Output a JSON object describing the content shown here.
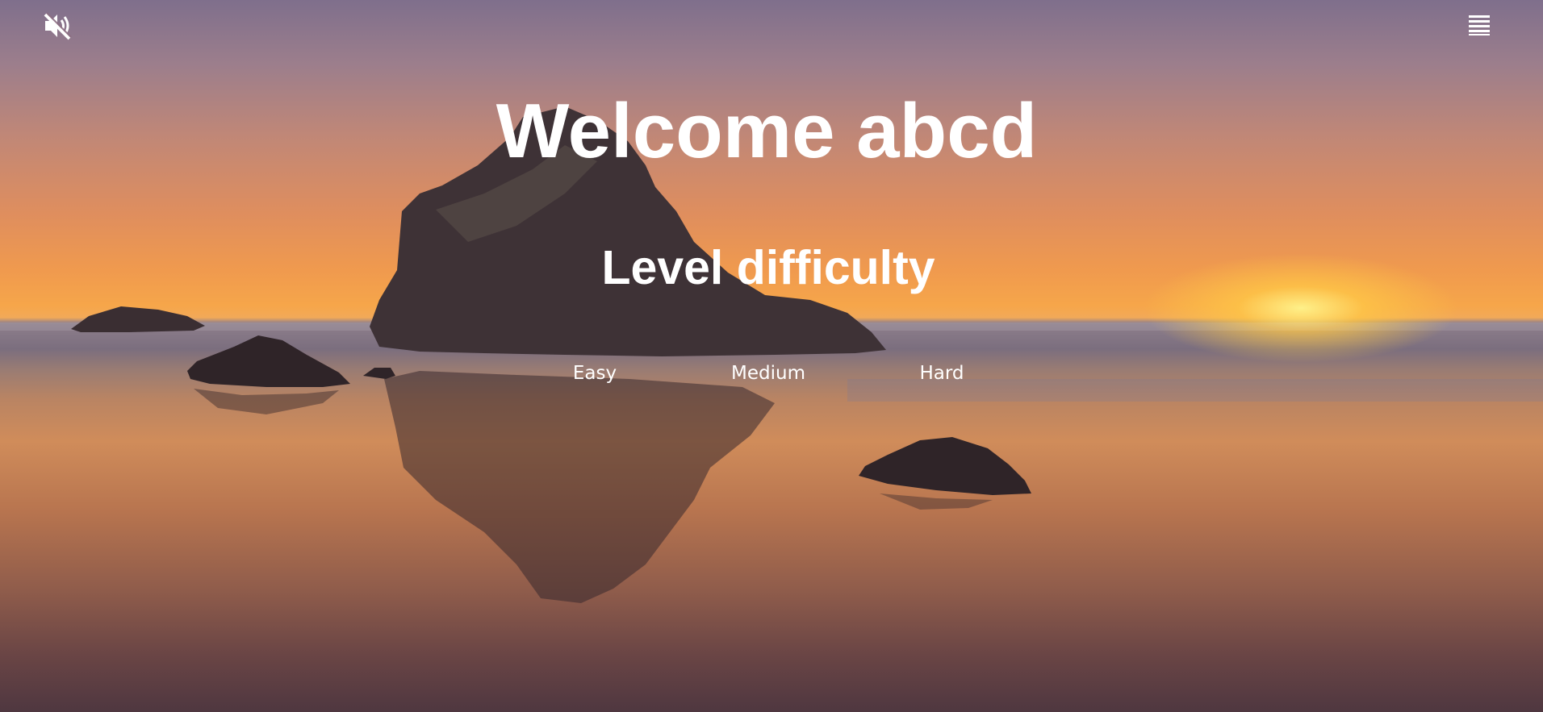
{
  "header": {
    "sound_icon": "speaker-muted-icon",
    "menu_icon": "hamburger-menu-icon"
  },
  "main": {
    "title": "Welcome abcd",
    "subtitle": "Level difficulty",
    "levels": [
      {
        "label": "Easy"
      },
      {
        "label": "Medium"
      },
      {
        "label": "Hard"
      }
    ]
  },
  "background": {
    "description_icon": "sunset-beach-background"
  },
  "colors": {
    "text": "#ffffff",
    "sky_top": "#7f6f8c",
    "sky_horizon": "#f6a64a",
    "sun": "#fff48c",
    "sand": "#8f5c4b"
  }
}
